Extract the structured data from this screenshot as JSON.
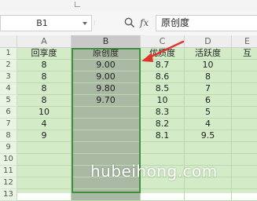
{
  "formula_bar": {
    "name_box": "B1",
    "fx_label": "fx",
    "formula_value": "原创度"
  },
  "columns": [
    "A",
    "B",
    "C",
    "D",
    "E"
  ],
  "rows": [
    "1",
    "2",
    "3",
    "4",
    "5",
    "6",
    "7",
    "8",
    "9",
    "10",
    "11",
    "12",
    "13"
  ],
  "cells": [
    [
      "回享度",
      "原创度",
      "优质度",
      "活跃度",
      "互"
    ],
    [
      "8",
      "9.00",
      "8.7",
      "10",
      ""
    ],
    [
      "8",
      "9.00",
      "8.6",
      "8",
      ""
    ],
    [
      "8",
      "9.80",
      "8.5",
      "7",
      ""
    ],
    [
      "8",
      "9.70",
      "10",
      "6",
      ""
    ],
    [
      "10",
      "",
      "8.3",
      "5",
      ""
    ],
    [
      "4",
      "",
      "8.2",
      "4",
      ""
    ],
    [
      "9",
      "",
      "8.1",
      "9.5",
      ""
    ],
    [
      "",
      "",
      "",
      "",
      ""
    ],
    [
      "",
      "",
      "",
      "",
      ""
    ],
    [
      "",
      "",
      "",
      "",
      ""
    ],
    [
      "",
      "",
      "",
      "",
      ""
    ],
    [
      "",
      "",
      "",
      "",
      ""
    ]
  ],
  "selected_column": "B",
  "watermark": "hubeihong.com",
  "colors": {
    "sheet_bg": "#d3ecc7",
    "selection_fill": "#a9b9a3",
    "selection_border": "#3f8f3f",
    "arrow": "#e0352b"
  }
}
